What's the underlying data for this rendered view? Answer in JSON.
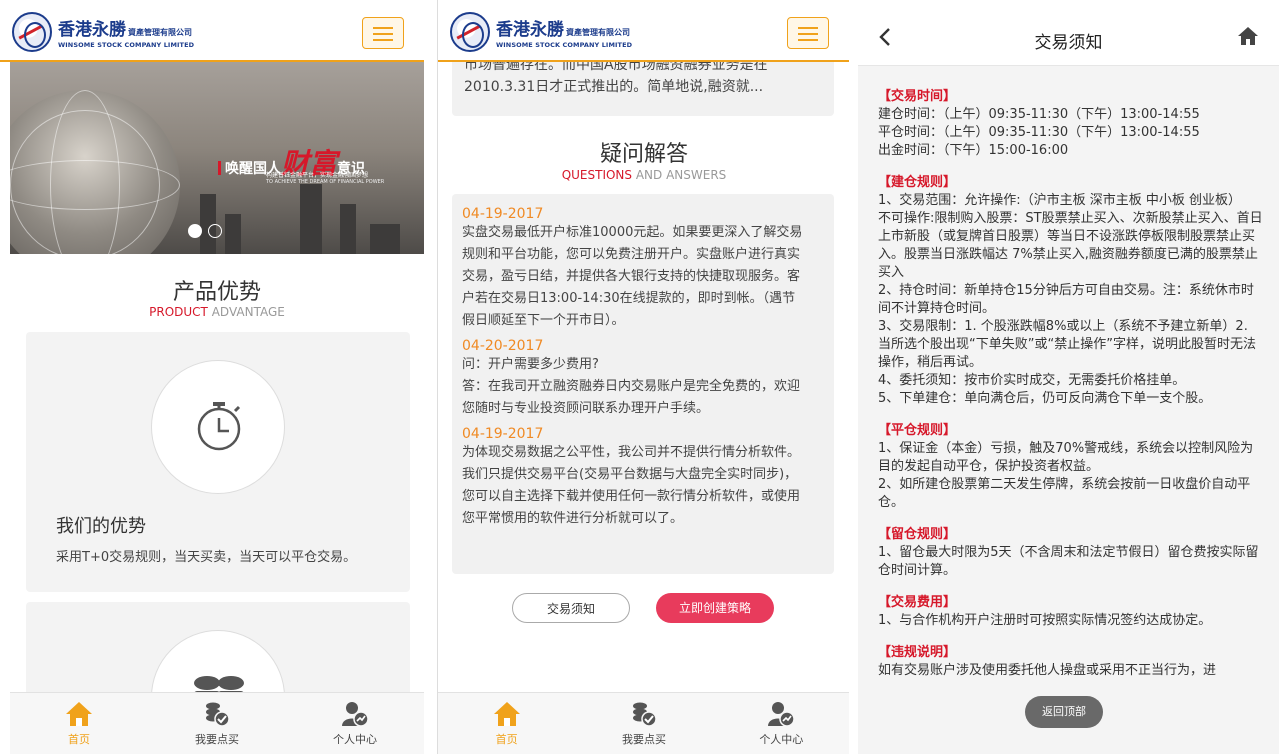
{
  "brand": {
    "name_cn": "香港永勝",
    "name_cn_small": "資產管理有限公司",
    "name_en": "WINSOME STOCK COMPANY LIMITED"
  },
  "banner": {
    "slogan_pre": "唤醒国人",
    "slogan_big": "财富",
    "slogan_post": "意识",
    "sub1": "构建普钰金融平台，实现金融强国梦想",
    "sub2": "TO ACHIEVE THE DREAM OF FINANCIAL POWER"
  },
  "panel1": {
    "section_title": "产品优势",
    "section_sub_red": "PRODUCT",
    "section_sub_gray": " ADVANTAGE",
    "card_title": "我们的优势",
    "card_text": "采用T+0交易规则，当天买卖，当天可以平仓交易。"
  },
  "panel2": {
    "intro_line1": "市场普遍存在。而中国A股市场融资融券业务是在",
    "intro_line2": "2010.3.31日才正式推出的。简单地说,融资就...",
    "section_title": "疑问解答",
    "section_sub_red": "QUESTIONS",
    "section_sub_gray": " AND ANSWERS",
    "qa": [
      {
        "date": "04-19-2017",
        "lines": [
          "实盘交易最低开户标准10000元起。如果要更深入了解交易",
          "规则和平台功能，您可以免费注册开户。实盘账户进行真实",
          "交易，盈亏日结，并提供各大银行支持的快捷取现服务。客",
          "户若在交易日13:00-14:30在线提款的，即时到帐。（遇节",
          "假日顺延至下一个开市日）。"
        ]
      },
      {
        "date": "04-20-2017",
        "lines": [
          "问：开户需要多少费用?",
          "答：在我司开立融资融券日内交易账户是完全免费的，欢迎",
          "您随时与专业投资顾问联系办理开户手续。"
        ]
      },
      {
        "date": "04-19-2017",
        "lines": [
          "为体现交易数据之公平性，我公司并不提供行情分析软件。",
          "我们只提供交易平台(交易平台数据与大盘完全实时同步)，",
          "您可以自主选择下载并使用任何一款行情分析软件，或使用",
          "您平常惯用的软件进行分析就可以了。"
        ]
      }
    ],
    "btn_notice": "交易须知",
    "btn_create": "立即创建策略"
  },
  "nav": {
    "home": "首页",
    "buy": "我要点买",
    "profile": "个人中心"
  },
  "panel3": {
    "title": "交易须知",
    "back_to_top": "返回顶部",
    "sections": [
      {
        "heading": "【交易时间】",
        "lines": [
          "建仓时间：（上午）09:35-11:30（下午）13:00-14:55",
          "平仓时间：（上午）09:35-11:30（下午）13:00-14:55",
          "出金时间：（下午）15:00-16:00"
        ]
      },
      {
        "heading": "【建仓规则】",
        "lines": [
          "1、交易范围：允许操作:（沪市主板 深市主板 中小板 创业板）",
          " 不可操作:限制购入股票：ST股票禁止买入、次新股禁止买入、首日上市新股（或复牌首日股票）等当日不设涨跌停板限制股票禁止买入。股票当日涨跌幅达 7%禁止买入,融资融券额度已满的股票禁止买入",
          "2、持仓时间：新单持仓15分钟后方可自由交易。注：系统休市时间不计算持仓时间。",
          "3、交易限制：1. 个股涨跌幅8%或以上（系统不予建立新单）2. 当所选个股出现“下单失败”或“禁止操作”字样，说明此股暂时无法操作，稍后再试。",
          "4、委托须知：按市价实时成交，无需委托价格挂单。",
          "5、下单建仓：单向满仓后，仍可反向满仓下单一支个股。"
        ]
      },
      {
        "heading": "【平仓规则】",
        "lines": [
          "1、保证金（本金）亏损，触及70%警戒线，系统会以控制风险为目的发起自动平仓，保护投资者权益。",
          "2、如所建仓股票第二天发生停牌，系统会按前一日收盘价自动平仓。"
        ]
      },
      {
        "heading": "【留仓规则】",
        "lines": [
          "1、留仓最大时限为5天（不含周末和法定节假日）留仓费按实际留仓时间计算。"
        ]
      },
      {
        "heading": "【交易费用】",
        "lines": [
          "1、与合作机构开户注册时可按照实际情况签约达成协定。"
        ]
      },
      {
        "heading": "【违规说明】",
        "lines": [
          "如有交易账户涉及使用委托他人操盘或采用不正当行为，进"
        ]
      }
    ]
  },
  "colors": {
    "accent": "#f0a21b",
    "red": "#d6182a",
    "button_red": "#e83b5c"
  }
}
